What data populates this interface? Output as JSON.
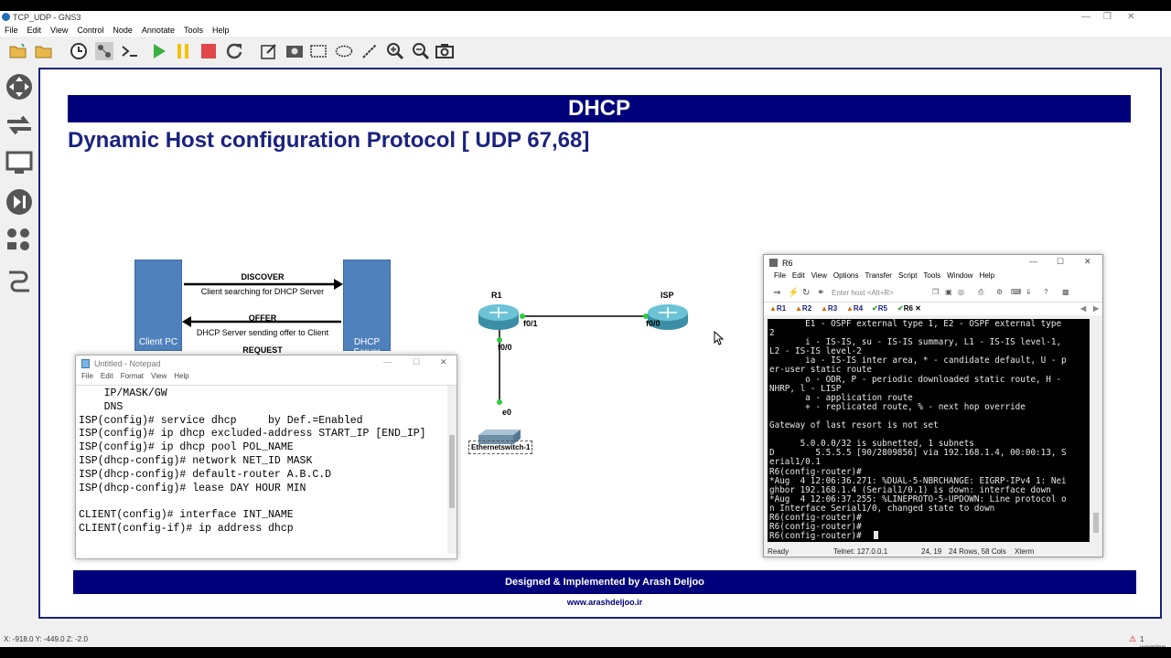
{
  "window": {
    "title": "TCP_UDP - GNS3",
    "menu": [
      "File",
      "Edit",
      "View",
      "Control",
      "Node",
      "Annotate",
      "Tools",
      "Help"
    ]
  },
  "slide": {
    "header": "DHCP",
    "subtitle": "Dynamic Host configuration Protocol [ UDP 67,68]",
    "footer": "Designed & Implemented by Arash Deljoo",
    "website": "www.arashdeljoo.ir"
  },
  "dhcp_diagram": {
    "client_label": "Client PC",
    "server_label": "DHCP Server",
    "discover": "DISCOVER",
    "discover_desc": "Client searching for DHCP Server",
    "offer": "OFFER",
    "offer_desc": "DHCP Server sending offer to Client",
    "request": "REQUEST"
  },
  "topology": {
    "r1": "R1",
    "isp": "ISP",
    "r1_f01": "f0/1",
    "isp_f00": "f0/0",
    "r1_f00": "f0/0",
    "sw_e0": "e0",
    "switch": "Ethernetswitch-1"
  },
  "notepad": {
    "title": "Untitled - Notepad",
    "menu": [
      "File",
      "Edit",
      "Format",
      "View",
      "Help"
    ],
    "text": "    IP/MASK/GW\n    DNS\nISP(config)# service dhcp     by Def.=Enabled\nISP(config)# ip dhcp excluded-address START_IP [END_IP]\nISP(config)# ip dhcp pool POL_NAME\nISP(dhcp-config)# network NET_ID MASK\nISP(dhcp-config)# default-router A.B.C.D\nISP(dhcp-config)# lease DAY HOUR MIN\n\nCLIENT(config)# interface INT_NAME\nCLIENT(config-if)# ip address dhcp"
  },
  "terminal": {
    "title": "R6",
    "menu": [
      "File",
      "Edit",
      "View",
      "Options",
      "Transfer",
      "Script",
      "Tools",
      "Window",
      "Help"
    ],
    "host_placeholder": "Enter host <Alt+R>",
    "tabs": [
      "R1",
      "R2",
      "R3",
      "R4",
      "R5",
      "R6"
    ],
    "text": "       E1 - OSPF external type 1, E2 - OSPF external type\n2\n       i - IS-IS, su - IS-IS summary, L1 - IS-IS level-1,\nL2 - IS-IS level-2\n       ia - IS-IS inter area, * - candidate default, U - p\ner-user static route\n       o - ODR, P - periodic downloaded static route, H -\nNHRP, l - LISP\n       a - application route\n       + - replicated route, % - next hop override\n\nGateway of last resort is not set\n\n      5.0.0.0/32 is subnetted, 1 subnets\nD        5.5.5.5 [90/2809856] via 192.168.1.4, 00:00:13, S\nerial1/0.1\nR6(config-router)#\n*Aug  4 12:06:36.271: %DUAL-5-NBRCHANGE: EIGRP-IPv4 1: Nei\nghbor 192.168.1.4 (Serial1/0.1) is down: interface down\n*Aug  4 12:06:37.255: %LINEPROTO-5-UPDOWN: Line protocol o\nn Interface Serial1/0, changed state to down\nR6(config-router)#\nR6(config-router)#\nR6(config-router)#",
    "status_ready": "Ready",
    "status_telnet": "Telnet: 127.0.0.1",
    "status_pos": "24, 19",
    "status_size": "24 Rows, 58 Cols",
    "status_term": "Xterm"
  },
  "statusbar": {
    "coords": "X: -918.0 Y: -449.0 Z: -2.0",
    "warning": "1 warning"
  },
  "colors": {
    "header_bg": "#00007a",
    "subtitle": "#1a237e",
    "box": "#4f81bd"
  }
}
